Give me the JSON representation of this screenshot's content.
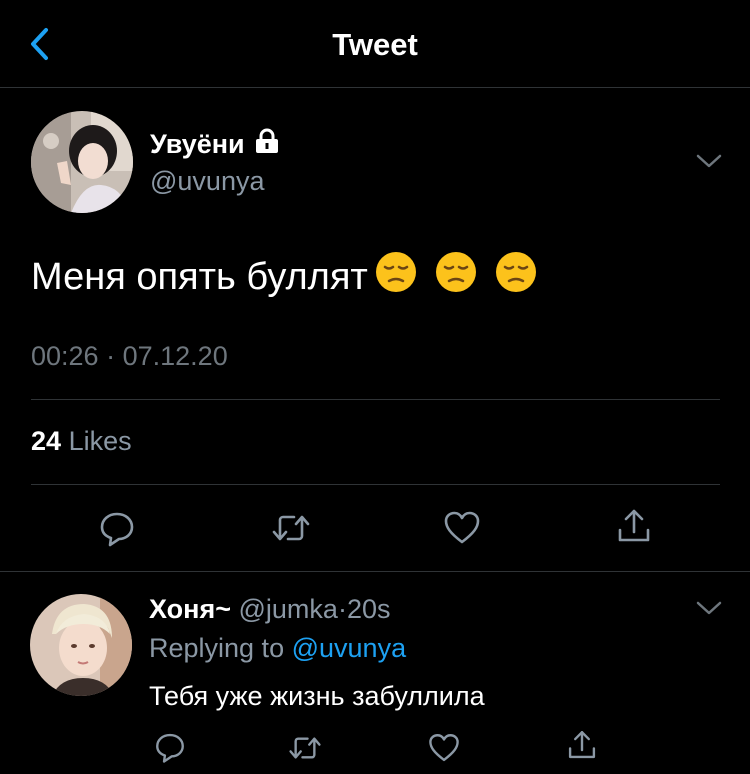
{
  "header": {
    "title": "Tweet",
    "back_icon": "chevron-left-icon"
  },
  "tweet": {
    "author_name": "Увуёни",
    "author_handle": "@uvunya",
    "protected_icon": "lock-icon",
    "text": "Меня опять буллят",
    "emojis": [
      "😔",
      "😔",
      "😔"
    ],
    "time": "00:26",
    "separator": "·",
    "date": "07.12.20",
    "likes_count": "24",
    "likes_label": "Likes",
    "actions": [
      "reply-icon",
      "retweet-icon",
      "like-icon",
      "share-icon"
    ]
  },
  "reply": {
    "author_name": "Хоня~",
    "author_handle": "@jumka",
    "separator": "·",
    "age": "20s",
    "replying_label": "Replying to",
    "replying_to": "@uvunya",
    "text": "Тебя уже жизнь забуллила"
  },
  "colors": {
    "background": "#000000",
    "accent": "#1da1f2",
    "muted_text": "#8b98a5",
    "divider": "#2f3336"
  }
}
